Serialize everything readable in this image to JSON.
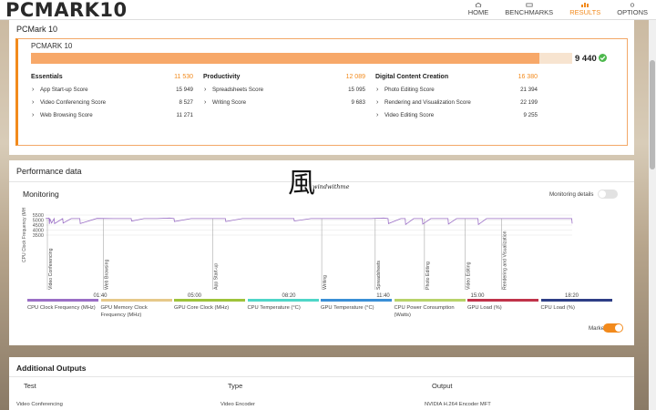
{
  "app": {
    "logo": "PCMARK10"
  },
  "nav": [
    {
      "label": "HOME",
      "icon": "home-icon",
      "active": false
    },
    {
      "label": "BENCHMARKS",
      "icon": "benchmarks-icon",
      "active": false
    },
    {
      "label": "RESULTS",
      "icon": "results-icon",
      "active": true
    },
    {
      "label": "OPTIONS",
      "icon": "gear-icon",
      "active": false
    }
  ],
  "colors": {
    "accent": "#f28a1c",
    "score_bar": "#f7a869",
    "check": "#4db84d"
  },
  "result": {
    "panel_title": "PCMark 10",
    "benchmark_name": "PCMARK 10",
    "score": "9 440",
    "score_fill_fraction": 0.94,
    "status_icon": "check-icon",
    "groups": [
      {
        "name": "Essentials",
        "score": "11 530",
        "tests": [
          {
            "name": "App Start-up Score",
            "score": "15 949"
          },
          {
            "name": "Video Conferencing Score",
            "score": "8 527"
          },
          {
            "name": "Web Browsing Score",
            "score": "11 271"
          }
        ]
      },
      {
        "name": "Productivity",
        "score": "12 089",
        "tests": [
          {
            "name": "Spreadsheets Score",
            "score": "15 095"
          },
          {
            "name": "Writing Score",
            "score": "9 683"
          }
        ]
      },
      {
        "name": "Digital Content Creation",
        "score": "16 380",
        "tests": [
          {
            "name": "Photo Editing Score",
            "score": "21 394"
          },
          {
            "name": "Rendering and Visualization Score",
            "score": "22 199"
          },
          {
            "name": "Video Editing Score",
            "score": "9 255"
          }
        ]
      }
    ]
  },
  "performance": {
    "title": "Performance data",
    "monitoring_title": "Monitoring",
    "monitoring_details_label": "Monitoring details",
    "monitoring_details_on": false,
    "markers_label": "Markers",
    "markers_on": true
  },
  "chart_data": {
    "type": "line",
    "ylabel": "CPU Clock Frequency (MHz)",
    "y_ticks": [
      "5500",
      "5000",
      "4500",
      "4000",
      "3500"
    ],
    "ylim": [
      3500,
      5500
    ],
    "x_ticks": [
      "01:40",
      "05:00",
      "08:20",
      "11:40",
      "15:00",
      "18:20"
    ],
    "xlim": [
      0,
      1230
    ],
    "grid": true,
    "series": [
      {
        "name": "CPU Clock Frequency (MHz)",
        "color": "#9b6fc6",
        "x": [
          0,
          8,
          9,
          10,
          14,
          20,
          21,
          40,
          41,
          60,
          80,
          81,
          120,
          160,
          200,
          201,
          230,
          260,
          290,
          300,
          301,
          340,
          380,
          420,
          421,
          460,
          500,
          540,
          580,
          581,
          620,
          660,
          700,
          740,
          760,
          790,
          800,
          801,
          830,
          840,
          841,
          860,
          880,
          881,
          900,
          920,
          940,
          941,
          960,
          980,
          1000,
          1010,
          1011,
          1030,
          1060,
          1100,
          1140,
          1180,
          1200,
          1229,
          1230
        ],
        "y": [
          5150,
          5200,
          4600,
          5150,
          4700,
          5150,
          4650,
          5150,
          4700,
          5150,
          5150,
          4650,
          5160,
          5150,
          5150,
          4900,
          5150,
          5150,
          5200,
          5150,
          4850,
          5150,
          5150,
          5150,
          4850,
          5150,
          5150,
          5150,
          5150,
          4900,
          5150,
          5150,
          5150,
          5150,
          5150,
          5200,
          5150,
          4650,
          5150,
          5150,
          4550,
          5150,
          5150,
          4600,
          5150,
          5150,
          5150,
          4600,
          5150,
          5150,
          5150,
          5150,
          4550,
          5150,
          5150,
          5150,
          5150,
          5150,
          5150,
          5150,
          4650
        ]
      }
    ],
    "phases": [
      {
        "label": "Video Conferencing",
        "x": 0
      },
      {
        "label": "Web Browsing",
        "x": 135
      },
      {
        "label": "App Start-up",
        "x": 390
      },
      {
        "label": "Writing",
        "x": 645
      },
      {
        "label": "Spreadsheets",
        "x": 770
      },
      {
        "label": "Photo Editing",
        "x": 885
      },
      {
        "label": "Video Editing",
        "x": 980
      },
      {
        "label": "Rendering and Visualization",
        "x": 1065
      }
    ],
    "legend_placement": "bottom",
    "legend": [
      {
        "name": "CPU Clock Frequency (MHz)",
        "color": "#9b6fc6"
      },
      {
        "name": "GPU Memory Clock Frequency (MHz)",
        "color": "#e6c98a"
      },
      {
        "name": "GPU Core Clock (MHz)",
        "color": "#9ec33b"
      },
      {
        "name": "CPU Temperature (°C)",
        "color": "#4fd6c8"
      },
      {
        "name": "GPU Temperature (°C)",
        "color": "#3a8fd6"
      },
      {
        "name": "CPU Power Consumption (Watts)",
        "color": "#b8d36a"
      },
      {
        "name": "GPU Load (%)",
        "color": "#c0334a"
      },
      {
        "name": "CPU Load (%)",
        "color": "#2e3e86"
      }
    ]
  },
  "outputs": {
    "title": "Additional Outputs",
    "headers": [
      "Test",
      "Type",
      "Output"
    ],
    "rows": [
      [
        "Video Conferencing",
        "Video Encoder",
        "NVIDIA H.264 Encoder MFT"
      ]
    ]
  },
  "watermark": {
    "glyph": "風",
    "text": "windwithme"
  }
}
